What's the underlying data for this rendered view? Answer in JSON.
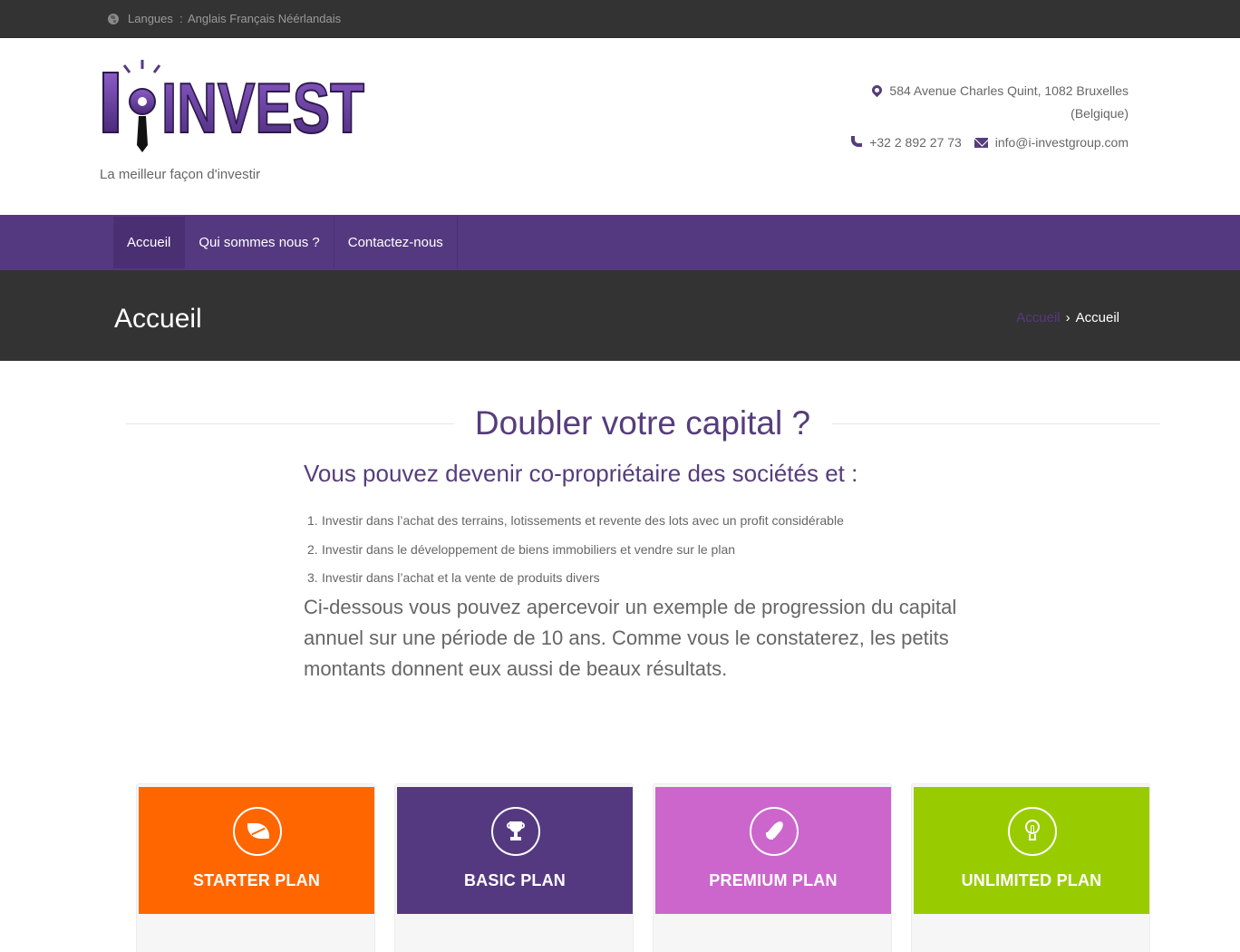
{
  "topbar": {
    "lang_label": "Langues",
    "lang_separator": ":",
    "languages": [
      "Anglais",
      "Français",
      "Néérlandais"
    ],
    "globe_icon": "globe-icon"
  },
  "header": {
    "logo_text": "INVEST",
    "logo_prefix": "I",
    "tagline": "La meilleur façon d'investir",
    "address_line1": "584 Avenue Charles Quint, 1082 Bruxelles",
    "address_line2": "(Belgique)",
    "phone": "+32 2 892 27 73",
    "email": "info@i-investgroup.com"
  },
  "nav": {
    "items": [
      {
        "label": "Accueil",
        "active": true
      },
      {
        "label": "Qui sommes nous ?",
        "active": false
      },
      {
        "label": "Contactez-nous",
        "active": false
      }
    ]
  },
  "titlebar": {
    "title": "Accueil",
    "breadcrumb_link": "Accueil",
    "breadcrumb_current": "Accueil"
  },
  "content": {
    "title": "Doubler votre capital ?",
    "subtitle": "Vous pouvez devenir co-propriétaire des sociétés et :",
    "steps": [
      {
        "num": "1.",
        "text": "Investir dans l’achat des terrains, lotissements et revente des lots avec un profit considérable"
      },
      {
        "num": "2.",
        "text": "Investir dans le développement de biens immobiliers et vendre sur le plan"
      },
      {
        "num": "3.",
        "text": "Investir dans l’achat et la vente de produits divers"
      }
    ],
    "intro": "Ci-dessous vous pouvez apercevoir un exemple de progression du capital annuel sur une période de 10 ans. Comme vous le constaterez, les petits montants donnent eux aussi de beaux résultats."
  },
  "plans": [
    {
      "name": "STARTER PLAN",
      "color": "#ff6600",
      "icon": "leaf-icon"
    },
    {
      "name": "BASIC PLAN",
      "color": "#553980",
      "icon": "trophy-icon"
    },
    {
      "name": "PREMIUM PLAN",
      "color": "#cc66cc",
      "icon": "rocket-icon"
    },
    {
      "name": "UNLIMITED PLAN",
      "color": "#99cc00",
      "icon": "lightbulb-icon"
    }
  ],
  "colors": {
    "brand_purple": "#553980",
    "dark_bar": "#333333",
    "title_purple": "#563d7c"
  }
}
